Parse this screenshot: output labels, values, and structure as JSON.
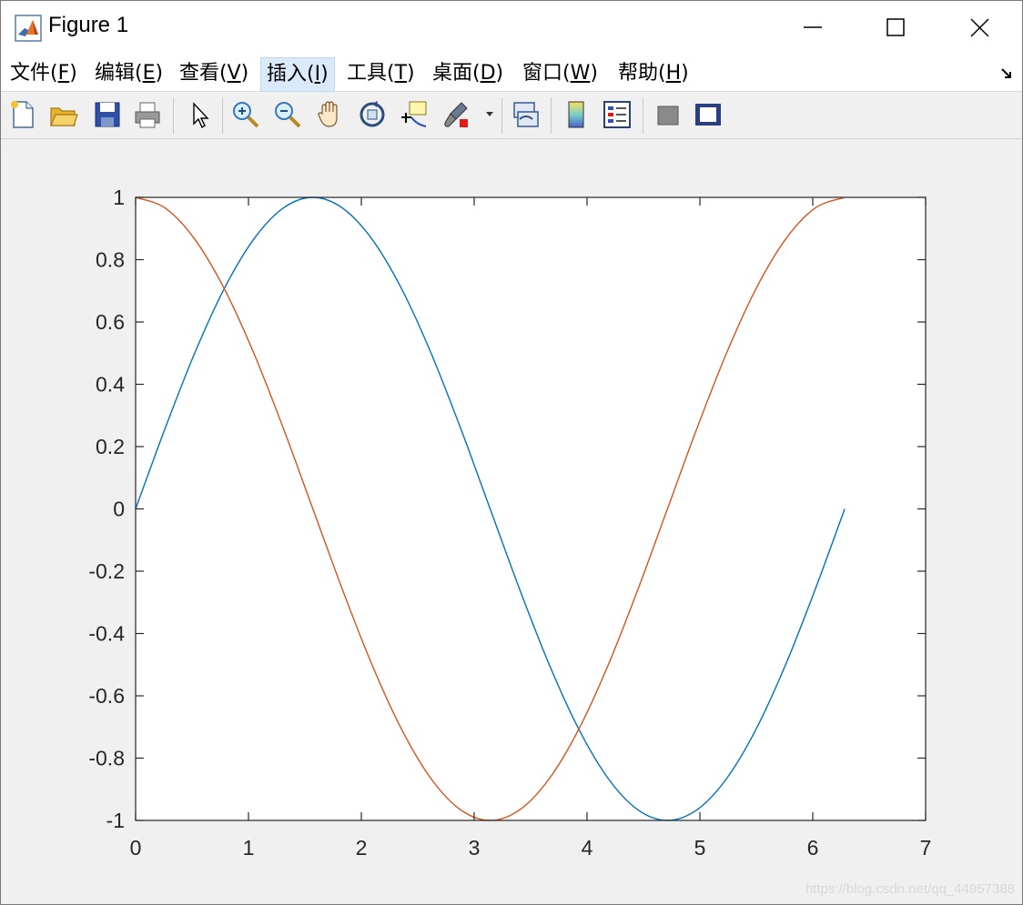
{
  "window": {
    "title": "Figure 1"
  },
  "menu": {
    "items": [
      {
        "prefix": "文件(",
        "key": "F",
        "suffix": ")"
      },
      {
        "prefix": "编辑(",
        "key": "E",
        "suffix": ")"
      },
      {
        "prefix": "查看(",
        "key": "V",
        "suffix": ")"
      },
      {
        "prefix": "插入(",
        "key": "I",
        "suffix": ")"
      },
      {
        "prefix": "工具(",
        "key": "T",
        "suffix": ")"
      },
      {
        "prefix": "桌面(",
        "key": "D",
        "suffix": ")"
      },
      {
        "prefix": "窗口(",
        "key": "W",
        "suffix": ")"
      },
      {
        "prefix": "帮助(",
        "key": "H",
        "suffix": ")"
      }
    ],
    "active_index": 3
  },
  "toolbar": {
    "icons": [
      "new-figure-icon",
      "open-file-icon",
      "save-icon",
      "print-icon",
      "pointer-icon",
      "zoom-in-icon",
      "zoom-out-icon",
      "pan-icon",
      "rotate-3d-icon",
      "data-cursor-icon",
      "brush-icon",
      "link-plot-icon",
      "colorbar-icon",
      "legend-icon",
      "hide-plot-tools-icon",
      "show-plot-tools-icon"
    ]
  },
  "watermark": "https://blog.csdn.net/qq_44957388",
  "colors": {
    "series_blue": "#0072bd",
    "series_orange": "#d95319"
  },
  "chart_data": {
    "type": "line",
    "title": "",
    "xlabel": "",
    "ylabel": "",
    "xlim": [
      0,
      7
    ],
    "ylim": [
      -1,
      1
    ],
    "xticks": [
      "0",
      "1",
      "2",
      "3",
      "4",
      "5",
      "6",
      "7"
    ],
    "yticks": [
      "-1",
      "-0.8",
      "-0.6",
      "-0.4",
      "-0.2",
      "0",
      "0.2",
      "0.4",
      "0.6",
      "0.8",
      "1"
    ],
    "grid": false,
    "legend": "none",
    "series": [
      {
        "x": [
          0,
          0.2618,
          0.5236,
          0.7854,
          1.0472,
          1.309,
          1.5708,
          1.8326,
          2.0944,
          2.3562,
          2.618,
          2.8798,
          3.1416,
          3.4034,
          3.6652,
          3.927,
          4.1888,
          4.4506,
          4.7124,
          4.9742,
          5.236,
          5.4978,
          5.7596,
          6.0214,
          6.2832
        ],
        "y": [
          0,
          0.2588,
          0.5,
          0.7071,
          0.866,
          0.9659,
          1,
          0.9659,
          0.866,
          0.7071,
          0.5,
          0.2588,
          0,
          -0.2588,
          -0.5,
          -0.7071,
          -0.866,
          -0.9659,
          -1,
          -0.9659,
          -0.866,
          -0.7071,
          -0.5,
          -0.2588,
          0
        ]
      },
      {
        "x": [
          0,
          0.2618,
          0.5236,
          0.7854,
          1.0472,
          1.309,
          1.5708,
          1.8326,
          2.0944,
          2.3562,
          2.618,
          2.8798,
          3.1416,
          3.4034,
          3.6652,
          3.927,
          4.1888,
          4.4506,
          4.7124,
          4.9742,
          5.236,
          5.4978,
          5.7596,
          6.0214,
          6.2832
        ],
        "y": [
          1,
          0.9659,
          0.866,
          0.7071,
          0.5,
          0.2588,
          0,
          -0.2588,
          -0.5,
          -0.7071,
          -0.866,
          -0.9659,
          -1,
          -0.9659,
          -0.866,
          -0.7071,
          -0.5,
          -0.2588,
          0,
          0.2588,
          0.5,
          0.7071,
          0.866,
          0.9659,
          1
        ]
      }
    ]
  }
}
